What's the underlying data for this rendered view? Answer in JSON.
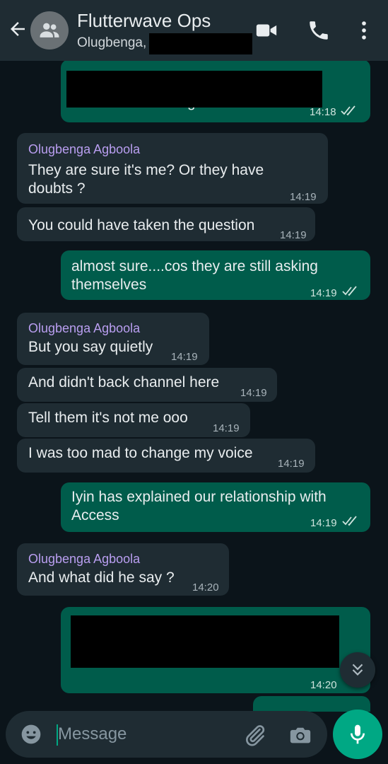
{
  "header": {
    "title": "Flutterwave Ops",
    "subtitle": "Olugbenga,"
  },
  "messages": [
    {
      "id": "m1",
      "direction": "out",
      "text": "taken that bit though",
      "time": "14:18",
      "redacted": true
    },
    {
      "id": "m2",
      "direction": "in",
      "sender": "Olugbenga Agboola",
      "lines": [
        "They are sure it's me? Or they have",
        "doubts ?"
      ],
      "time": "14:19"
    },
    {
      "id": "m3",
      "direction": "in",
      "text": "You could have taken the question",
      "time": "14:19"
    },
    {
      "id": "m4",
      "direction": "out",
      "lines": [
        "almost sure....cos they are still asking",
        "themselves"
      ],
      "time": "14:19"
    },
    {
      "id": "m5",
      "direction": "in",
      "sender": "Olugbenga Agboola",
      "text": "But you say quietly",
      "time": "14:19"
    },
    {
      "id": "m6",
      "direction": "in",
      "text": "And didn't back channel here",
      "time": "14:19"
    },
    {
      "id": "m7",
      "direction": "in",
      "text": "Tell them it's not me ooo",
      "time": "14:19"
    },
    {
      "id": "m8",
      "direction": "in",
      "text": "I was too mad to change my voice",
      "time": "14:19"
    },
    {
      "id": "m9",
      "direction": "out",
      "lines": [
        "Iyin has explained our relationship with",
        "Access"
      ],
      "time": "14:19"
    },
    {
      "id": "m10",
      "direction": "in",
      "sender": "Olugbenga Agboola",
      "text": "And what did he say ?",
      "time": "14:20"
    },
    {
      "id": "m11",
      "direction": "out",
      "time": "14:20",
      "redacted": true
    }
  ],
  "composer": {
    "placeholder": "Message"
  },
  "colors": {
    "header_bg": "#1f2c33",
    "chat_bg": "#0b141a",
    "incoming_bubble": "#1f2c33",
    "outgoing_bubble": "#005c4b",
    "sender_name": "#b99ef0",
    "accent": "#00a884",
    "read_ticks": "#cfe4de"
  },
  "icons": {
    "back": "arrow-left-icon",
    "avatar": "group-icon",
    "video": "video-call-icon",
    "call": "phone-icon",
    "menu": "more-vert-icon",
    "emoji": "emoji-icon",
    "attach": "paperclip-icon",
    "camera": "camera-icon",
    "mic": "mic-icon",
    "scroll": "double-chevron-down-icon"
  }
}
